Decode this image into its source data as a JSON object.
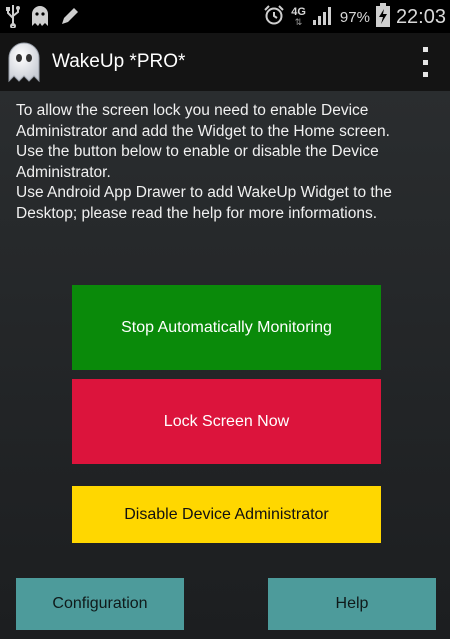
{
  "status_bar": {
    "icons_left": [
      "usb-icon",
      "ghost-notification-icon",
      "pencil-icon"
    ],
    "alarm_icon": "alarm-clock-icon",
    "network_type": "4G",
    "battery_percent": "97%",
    "time": "22:03"
  },
  "action_bar": {
    "app_title": "WakeUp *PRO*",
    "overflow_icon": "overflow-menu-icon"
  },
  "instructions": {
    "line1": "To allow the screen lock you need to enable Device Administrator and add the Widget to the Home screen.",
    "line2": "Use the button below to enable or disable the Device Administrator.",
    "line3": "Use Android App Drawer to add WakeUp Widget to the Desktop; please read the help for more informations."
  },
  "buttons": {
    "monitoring": "Stop Automatically Monitoring",
    "lock": "Lock Screen Now",
    "admin": "Disable Device Administrator",
    "configuration": "Configuration",
    "help": "Help"
  },
  "colors": {
    "monitoring": "#0a8a0a",
    "lock": "#dc143c",
    "admin": "#ffd700",
    "secondary": "#4d9b9b"
  }
}
